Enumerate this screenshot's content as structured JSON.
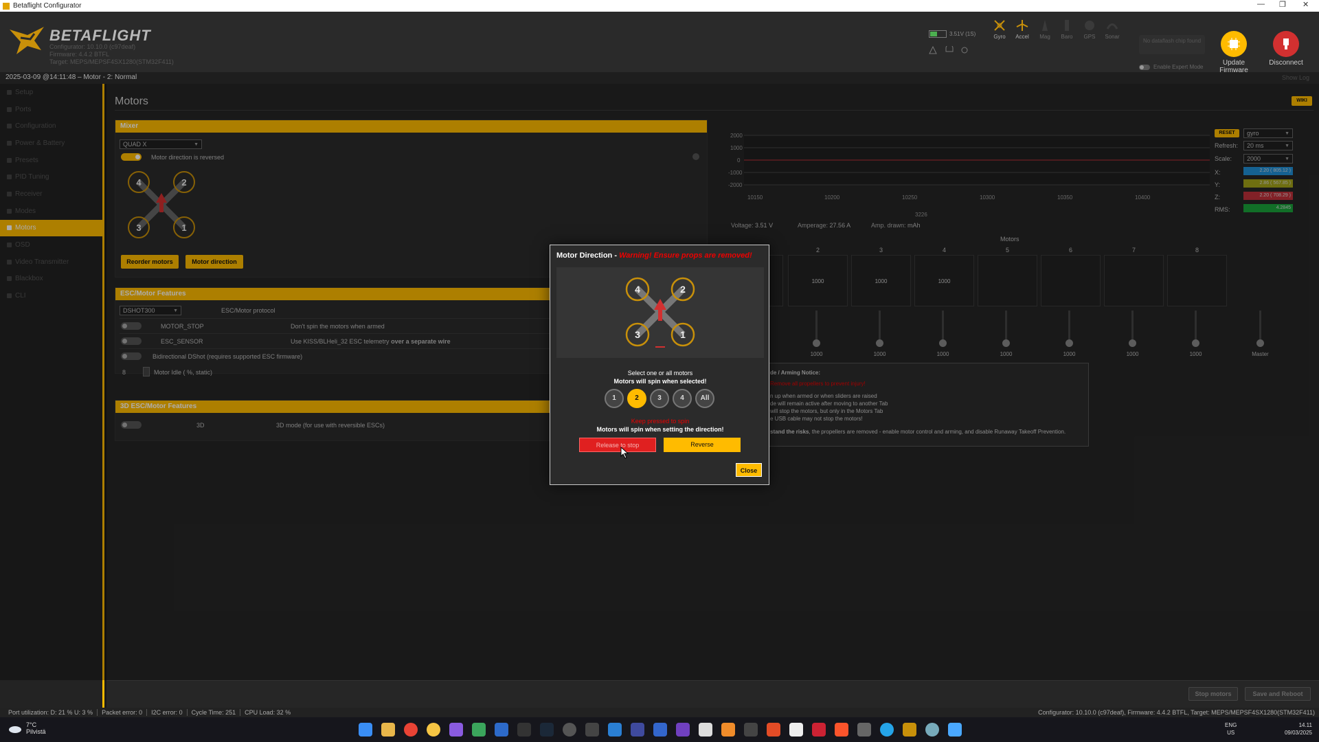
{
  "window": {
    "title": "Betaflight Configurator"
  },
  "header": {
    "brand": "BETAFLIGHT",
    "configurator_version": "Configurator: 10.10.0 (c97deaf)",
    "firmware": "Firmware: 4.4.2 BTFL",
    "target": "Target: MEPS/MEPSF4SX1280(STM32F411)",
    "battery": "3.51V (1S)",
    "sensors": [
      "Gyro",
      "Accel",
      "Mag",
      "Baro",
      "GPS",
      "Sonar"
    ],
    "no_dataflash": "No dataflash chip found",
    "expert_mode": "Enable Expert Mode",
    "update_firmware": "Update Firmware",
    "disconnect": "Disconnect"
  },
  "statusline": {
    "text": "2025-03-09 @14:11:48 – Motor - 2: Normal",
    "show_log": "Show Log"
  },
  "sidebar": {
    "items": [
      {
        "label": "Setup"
      },
      {
        "label": "Ports"
      },
      {
        "label": "Configuration"
      },
      {
        "label": "Power & Battery"
      },
      {
        "label": "Presets"
      },
      {
        "label": "PID Tuning"
      },
      {
        "label": "Receiver"
      },
      {
        "label": "Modes"
      },
      {
        "label": "Motors",
        "active": true
      },
      {
        "label": "OSD"
      },
      {
        "label": "Video Transmitter"
      },
      {
        "label": "Blackbox"
      },
      {
        "label": "CLI"
      }
    ]
  },
  "page": {
    "title": "Motors",
    "wiki": "WIKI"
  },
  "mixer": {
    "header": "Mixer",
    "type": "QUAD X",
    "reversed_label": "Motor direction is reversed",
    "reversed_on": true,
    "reorder_btn": "Reorder motors",
    "direction_btn": "Motor direction"
  },
  "esc": {
    "header": "ESC/Motor Features",
    "protocol": "DSHOT300",
    "protocol_label": "ESC/Motor protocol",
    "motor_stop": "MOTOR_STOP",
    "motor_stop_desc": "Don't spin the motors when armed",
    "esc_sensor": "ESC_SENSOR",
    "esc_sensor_desc_a": "Use KISS/BLHeli_32 ESC telemetry",
    "esc_sensor_desc_b": "over a separate wire",
    "bidir": "Bidirectional DShot (requires supported ESC firmware)",
    "idle_value": "8",
    "idle_label": "Motor Idle ( %, static)"
  },
  "esc3d": {
    "header": "3D ESC/Motor Features",
    "label": "3D",
    "desc": "3D mode (for use with reversible ESCs)"
  },
  "graph": {
    "y_ticks": [
      "2000",
      "1000",
      "0",
      "-1000",
      "-2000"
    ],
    "x_ticks": [
      "10150",
      "10200",
      "10250",
      "10300",
      "10350",
      "10400"
    ],
    "counter": "3226",
    "reset": "RESET",
    "sensor": "gyro",
    "refresh_label": "Refresh:",
    "refresh": "20 ms",
    "scale_label": "Scale:",
    "scale": "2000",
    "x_label": "X:",
    "x_val": "2.20 ( 805.12 )",
    "y_label": "Y:",
    "y_val": "2.86 ( 567.85 )",
    "z_label": "Z:",
    "z_val": "2.20 ( 708.29 )",
    "rms_label": "RMS:",
    "rms_val": "4.2845",
    "colors": {
      "x": "#1f8fd6",
      "y": "#a3a318",
      "z": "#c0313a",
      "rms": "#1aa33a"
    }
  },
  "telemetry": {
    "voltage_label": "Voltage:",
    "voltage": "3.51 V",
    "amperage_label": "Amperage:",
    "amperage": "27.56 A",
    "drawn_label": "Amp. drawn:",
    "drawn": "mAh"
  },
  "motors": {
    "title": "Motors",
    "numbers": [
      "2",
      "3",
      "4",
      "5",
      "6",
      "7",
      "8"
    ],
    "box_values": [
      "1000",
      "1000",
      "1000",
      "",
      "",
      "",
      ""
    ],
    "slider_values": [
      "1000",
      "1000",
      "1000",
      "1000",
      "1000",
      "1000",
      "1000"
    ],
    "master": "Master"
  },
  "notice": {
    "title": "de / Arming Notice:",
    "red": "Remove all propellers to prevent injury!",
    "line1": "n up when armed or when sliders are raised",
    "line2": "de will remain active after moving to another Tab",
    "line3": "will stop the motors, but only in the Motors Tab",
    "line4": "e USB cable may not stop the motors!",
    "understand_bold": "stand the risks",
    "understand_rest": ", the propellers are removed - enable motor control and arming, and disable Runaway Takeoff Prevention."
  },
  "modal": {
    "title": "Motor Direction - ",
    "warning": "Warning! Ensure props are removed!",
    "select_line1": "Select one or all motors",
    "select_line2": "Motors will spin when selected!",
    "buttons": [
      "1",
      "2",
      "3",
      "4",
      "All"
    ],
    "selected": "2",
    "hold_text": "Keep pressed to spin",
    "spin_text": "Motors will spin when setting the direction!",
    "release": "Release to stop",
    "reverse": "Reverse",
    "close": "Close"
  },
  "footer": {
    "stop_motors": "Stop motors",
    "save_reboot": "Save and Reboot"
  },
  "statusbar": {
    "port": "Port utilization: D: 21 % U: 3 %",
    "packet": "Packet error: 0",
    "i2c": "I2C error: 0",
    "cycle": "Cycle Time: 251",
    "cpu": "CPU Load: 32 %",
    "right": "Configurator: 10.10.0 (c97deaf), Firmware: 4.4.2 BTFL, Target: MEPS/MEPSF4SX1280(STM32F411)"
  },
  "taskbar": {
    "temp": "7°C",
    "weather": "Pilvistä",
    "lang1": "ENG",
    "lang2": "US",
    "time": "14.11",
    "date": "09/03/2025"
  }
}
